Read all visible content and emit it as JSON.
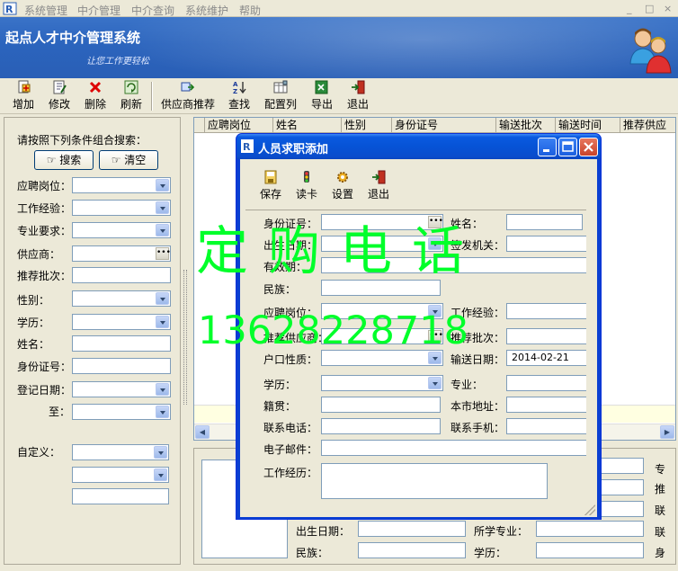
{
  "menubar": {
    "items": [
      "系统管理",
      "中介管理",
      "中介查询",
      "系统维护",
      "帮助"
    ],
    "controls": [
      "_",
      "□",
      "×"
    ]
  },
  "banner": {
    "title": "起点人才中介管理系统",
    "subtitle": "让您工作更轻松"
  },
  "toolbar": {
    "buttons": [
      {
        "label": "增加",
        "icon": "add-icon"
      },
      {
        "label": "修改",
        "icon": "edit-icon"
      },
      {
        "label": "删除",
        "icon": "delete-icon"
      },
      {
        "label": "刷新",
        "icon": "refresh-icon"
      },
      {
        "label": "供应商推荐",
        "icon": "recommend-icon"
      },
      {
        "label": "查找",
        "icon": "sort-find-icon"
      },
      {
        "label": "配置列",
        "icon": "columns-icon"
      },
      {
        "label": "导出",
        "icon": "export-icon"
      },
      {
        "label": "退出",
        "icon": "exit-icon"
      }
    ]
  },
  "search_panel": {
    "heading": "请按照下列条件组合搜索：",
    "search_label": "搜索",
    "clear_label": "清空",
    "fields": {
      "position": "应聘岗位：",
      "experience": "工作经验：",
      "major_req": "专业要求：",
      "supplier": "供应商：",
      "batch": "推荐批次：",
      "gender": "性别：",
      "education": "学历：",
      "name": "姓名：",
      "id_number": "身份证号：",
      "reg_date": "登记日期：",
      "to": "至：",
      "custom": "自定义："
    }
  },
  "grid": {
    "columns": [
      "应聘岗位",
      "姓名",
      "性别",
      "身份证号",
      "输送批次",
      "输送时间",
      "推荐供应"
    ]
  },
  "detail": {
    "labels": {
      "birth": "出生日期：",
      "school_major": "所学专业：",
      "ethnicity": "民族：",
      "education": "学历：",
      "r1": "专",
      "r2": "推",
      "r3": "联",
      "r4": "联",
      "r5": "身"
    }
  },
  "dialog": {
    "title": "人员求职添加",
    "toolbar": [
      {
        "label": "保存",
        "icon": "save-icon"
      },
      {
        "label": "读卡",
        "icon": "card-reader-icon"
      },
      {
        "label": "设置",
        "icon": "settings-icon"
      },
      {
        "label": "退出",
        "icon": "exit-icon"
      }
    ],
    "fields": {
      "id_number": "身份证号：",
      "name": "姓名：",
      "birth": "出生日期：",
      "issuer": "签发机关：",
      "valid": "有效期：",
      "ethnicity": "民族：",
      "position": "应聘岗位：",
      "experience": "工作经验：",
      "supplier": "推荐供应商：",
      "batch": "推荐批次：",
      "hukou": "户口性质：",
      "send_date": "输送日期：",
      "education": "学历：",
      "major": "专业：",
      "native": "籍贯：",
      "address": "本市地址：",
      "phone": "联系电话：",
      "mobile": "联系手机：",
      "email": "电子邮件：",
      "work_history": "工作经历："
    },
    "values": {
      "send_date": "2014-02-21"
    }
  },
  "watermark": {
    "line1": "定购电话",
    "line2": "13628228718"
  },
  "colors": {
    "banner": "#2b64bd",
    "dialog_title": "#0653d6",
    "watermark": "#00ff2a",
    "window_bg": "#ECE9D8"
  }
}
